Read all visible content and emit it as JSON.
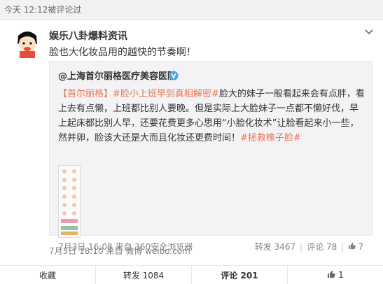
{
  "topbar": {
    "timestamp": "今天 12:12被评论过"
  },
  "post": {
    "author": "娱乐八卦爆料资讯",
    "text": "脸也大化妆品用的越快的节奏啊！",
    "meta": "7月3日 18:10 来自 微博 weibo.com"
  },
  "retweet": {
    "author": "@上海首尔丽格医疗美容医院",
    "body": {
      "p1": "【首尔丽格】",
      "p2": "#脸小上班早到真相解密#",
      "p3": "脸大的妹子一般看起来会有点胖，看上去有点懒，上班都比别人要晚。但是实际上大脸妹子一点都不懒好伐，早上起床都比别人早，还要花费更多心思用“小脸化妆术”让脸看起来小一些，然并卵，脸该大还是大而且化妆还更费时间！",
      "p4": "#拯救橡子脸#"
    },
    "meta": "7月3日 16:08 来自 360安全浏览器",
    "repost": "转发 3467",
    "comment": "评论 78",
    "like": "7"
  },
  "actions": {
    "favorite": "收藏",
    "repost": "转发 1084",
    "comment": "评论 201",
    "like": "1"
  },
  "colors": {
    "accent": "#eb7350",
    "link": "#eb7350",
    "bg": "#f2f2f5"
  },
  "icons": [
    "chevron-down-icon",
    "verified-badge-icon",
    "thumbs-up-icon"
  ]
}
